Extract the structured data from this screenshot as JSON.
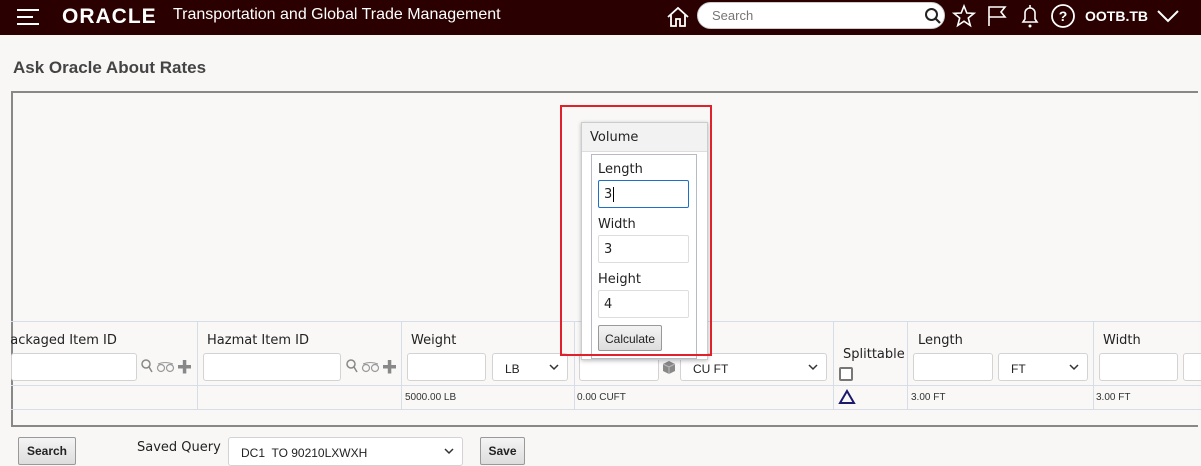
{
  "header": {
    "app_title": "Transportation and Global Trade Management",
    "brand": "ORACLE",
    "search_placeholder": "Search",
    "user": "OOTB.TB",
    "bg_color": "#2a0000"
  },
  "page": {
    "title": "Ask Oracle About Rates"
  },
  "columns": {
    "packaged_item": {
      "label": "Packaged Item ID",
      "visible_label": "ackaged Item ID",
      "value": ""
    },
    "hazmat_item": {
      "label": "Hazmat Item ID",
      "value": ""
    },
    "weight": {
      "label": "Weight",
      "value": "",
      "unit": "LB",
      "summary": "5000.00 LB"
    },
    "volume": {
      "value": "",
      "unit": "CU FT",
      "summary": "0.00 CUFT"
    },
    "splittable": {
      "label": "Splittable",
      "checked": false
    },
    "length": {
      "label": "Length",
      "value": "",
      "unit": "FT",
      "summary": "3.00 FT"
    },
    "width": {
      "label": "Width",
      "value": "",
      "summary": "3.00 FT"
    }
  },
  "volume_popup": {
    "title": "Volume",
    "length_label": "Length",
    "length_value": "3",
    "width_label": "Width",
    "width_value": "3",
    "height_label": "Height",
    "height_value": "4",
    "calculate_label": "Calculate",
    "highlight_color": "#e0202a"
  },
  "footer": {
    "search_label": "Search",
    "saved_query_label": "Saved Query",
    "saved_query_value": "DC1  TO 90210LXWXH",
    "save_label": "Save"
  }
}
